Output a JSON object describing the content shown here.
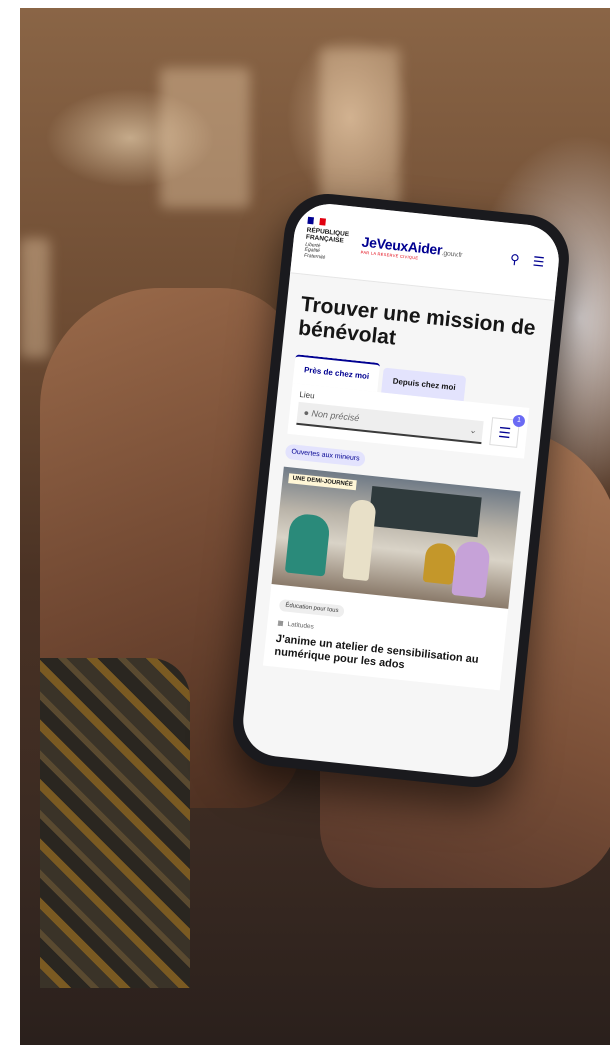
{
  "site": {
    "republique": [
      "RÉPUBLIQUE",
      "FRANÇAISE"
    ],
    "motto": [
      "Liberté",
      "Égalité",
      "Fraternité"
    ],
    "brand_name": "JeVeuxAider",
    "brand_suffix": ".gouv.fr",
    "brand_tagline": "PAR LA RÉSERVE CIVIQUE",
    "flag_colors": [
      "#000091",
      "#ffffff",
      "#e1000f"
    ]
  },
  "header": {
    "search_icon": "search-icon",
    "menu_icon": "menu-icon"
  },
  "page": {
    "title": "Trouver une mission de bénévolat"
  },
  "tabs": [
    {
      "label": "Près de chez moi",
      "active": true
    },
    {
      "label": "Depuis chez moi",
      "active": false
    }
  ],
  "location": {
    "label": "Lieu",
    "value": "Non précisé"
  },
  "filters": {
    "badge_count": "1"
  },
  "chips": {
    "minors": "Ouvertes aux mineurs"
  },
  "mission_card": {
    "duration_badge": "UNE DEMI-JOURNÉE",
    "domain": "Éducation pour tous",
    "organization": "Latitudes",
    "title": "J'anime un atelier de sensibilisation au numérique pour les ados"
  },
  "colors": {
    "accent": "#000091",
    "accent_light": "#e3e3fd",
    "badge": "#6a6af4"
  }
}
